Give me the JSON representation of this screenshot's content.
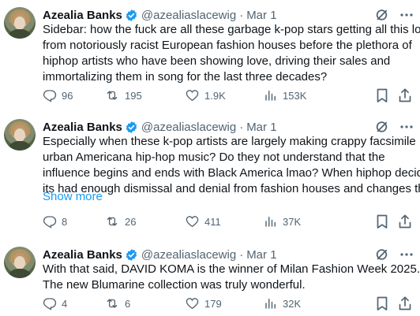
{
  "tweets": [
    {
      "name": "Azealia Banks",
      "handle": "@azealiaslacewig",
      "separator": "·",
      "date": "Mar 1",
      "text_lines": [
        "Sidebar: how the fuck are all these garbage k-pop stars getting all this love",
        "from notoriously racist European fashion houses before the plethora of",
        "hiphop artists who have been showing love, driving their sales and",
        "immortalizing them in song for the last three decades?"
      ],
      "show_more": "",
      "replies": "96",
      "reposts": "195",
      "likes": "1.9K",
      "views": "153K"
    },
    {
      "name": "Azealia Banks",
      "handle": "@azealiaslacewig",
      "separator": "·",
      "date": "Mar 1",
      "text_lines": [
        "Especially when these k-pop artists are largely making crappy facsimile",
        "urban Americana hip-hop music? Do they not understand that the",
        "influence begins and ends with Black America lmao? When hiphop decides",
        "its had enough dismissal and denial from fashion houses and changes the"
      ],
      "show_more": "Show more",
      "replies": "8",
      "reposts": "26",
      "likes": "411",
      "views": "37K"
    },
    {
      "name": "Azealia Banks",
      "handle": "@azealiaslacewig",
      "separator": "·",
      "date": "Mar 1",
      "text_lines": [
        "With that said, DAVID KOMA is the winner of Milan Fashion Week 2025.",
        "The new Blumarine collection was truly wonderful."
      ],
      "show_more": "",
      "replies": "4",
      "reposts": "6",
      "likes": "179",
      "views": "32K"
    }
  ],
  "icons": {
    "verified": "verified-badge-icon",
    "grok": "grok-icon",
    "more": "more-icon",
    "reply": "reply-icon",
    "repost": "repost-icon",
    "like": "like-icon",
    "views": "views-icon",
    "bookmark": "bookmark-icon",
    "share": "share-icon"
  },
  "colors": {
    "text": "#0f1419",
    "secondary": "#536471",
    "link": "#1d9bf0",
    "verified": "#1d9bf0"
  }
}
